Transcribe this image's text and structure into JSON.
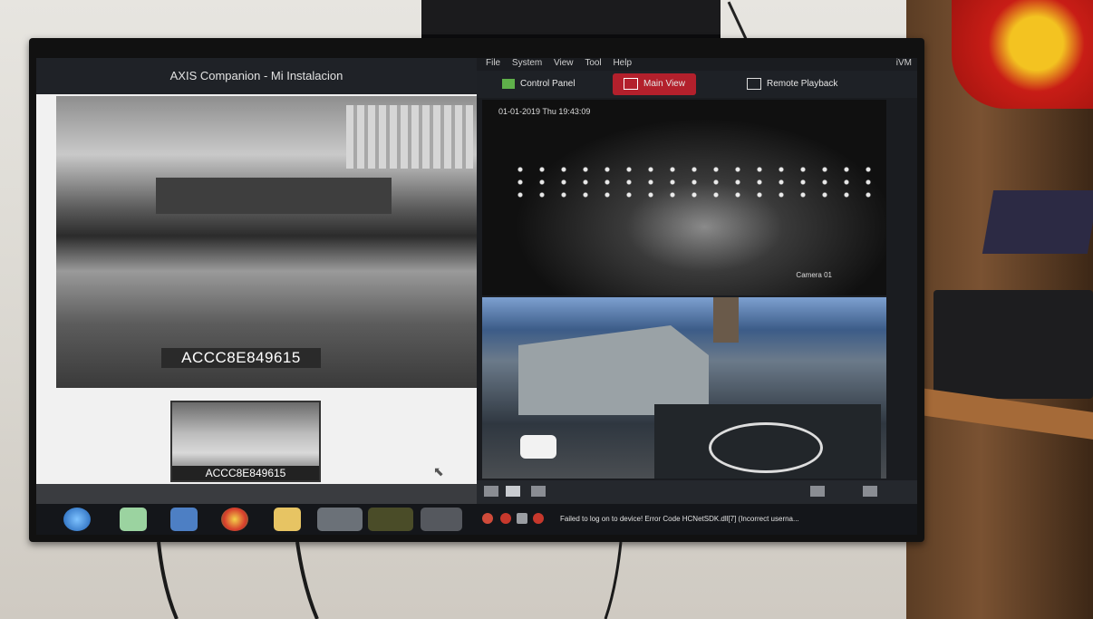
{
  "photo": {
    "monitor": {
      "axis_window": {
        "title": "AXIS Companion - Mi Instalacion",
        "camera_label": "ACCC8E849615",
        "thumbnail_label": "ACCC8E849615"
      },
      "ivms_window": {
        "menu": [
          "File",
          "System",
          "View",
          "Tool",
          "Help"
        ],
        "brand": "iVM",
        "tabs": [
          {
            "label": "Control Panel",
            "active": false
          },
          {
            "label": "Main View",
            "active": true
          },
          {
            "label": "Remote Playback",
            "active": false
          }
        ],
        "camera1_osd": "01-01-2019 Thu 19:43:09",
        "camera1_name": "Camera 01",
        "status_message": "Failed to log on to device! Error Code HCNetSDK.dll[7] (Incorrect userna..."
      }
    }
  }
}
